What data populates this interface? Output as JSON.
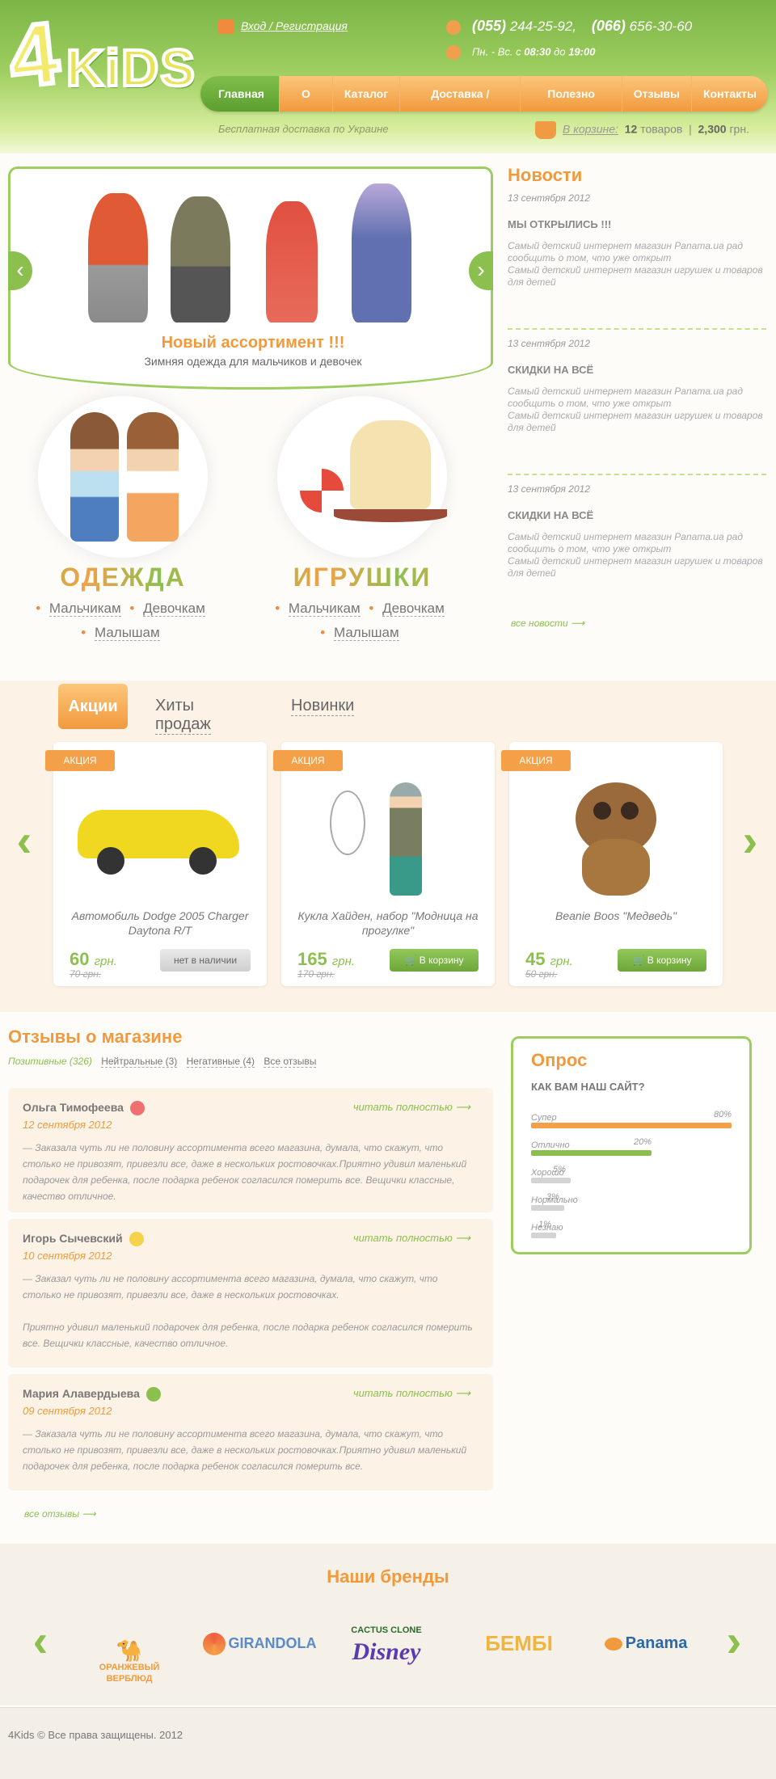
{
  "header": {
    "logo_text": "4KiDS",
    "login": "Вход / Регистрация",
    "phone1_code": "(055)",
    "phone1_num": "244-25-92,",
    "phone2_code": "(066)",
    "phone2_num": "656-30-60",
    "hours_prefix": "Пн. - Вс. с",
    "hours_from": "08:30",
    "hours_mid": "до",
    "hours_to": "19:00",
    "delivery": "Бесплатная доставка по Украине",
    "cart_label": "В корзине:",
    "cart_count": "12",
    "cart_items_word": "товаров",
    "cart_sum": "2,300",
    "cart_currency": "грн."
  },
  "nav": [
    "Главная",
    "О нас",
    "Каталог",
    "Доставка / Оплата",
    "Полезно знать",
    "Отзывы",
    "Контакты"
  ],
  "slider": {
    "title": "Новый ассортимент !!!",
    "subtitle": "Зимняя одежда для мальчиков и девочек"
  },
  "categories": [
    {
      "title": "ОДЕЖДА",
      "links": [
        "Мальчикам",
        "Девочкам",
        "Малышам"
      ]
    },
    {
      "title": "ИГРУШКИ",
      "links": [
        "Мальчикам",
        "Девочкам",
        "Малышам"
      ]
    }
  ],
  "news": {
    "heading": "Новости",
    "items": [
      {
        "date": "13 сентября 2012",
        "title": "МЫ ОТКРЫЛИСЬ !!!",
        "text1": "Самый детский интернет магазин Panama.ua рад сообщить о том, что уже открыт",
        "text2": "Самый детский интернет магазин игрушек и товаров для детей"
      },
      {
        "date": "13 сентября 2012",
        "title": "СКИДКИ НА ВСЁ",
        "text1": "Самый детский интернет магазин Panama.ua рад сообщить о том, что уже открыт",
        "text2": "Самый детский интернет магазин игрушек и товаров для детей"
      },
      {
        "date": "13 сентября 2012",
        "title": "СКИДКИ НА ВСЁ",
        "text1": "Самый детский интернет магазин Panama.ua рад сообщить о том, что уже открыт",
        "text2": "Самый детский интернет магазин игрушек и товаров для детей"
      }
    ],
    "all": "все новости ⟶"
  },
  "product_tabs": [
    "Акции",
    "Хиты продаж",
    "Новинки"
  ],
  "products": [
    {
      "badge": "АКЦИЯ",
      "name": "Автомобиль Dodge 2005 Charger Daytona R/T",
      "price": "60",
      "currency": "грн.",
      "old": "70 грн.",
      "button": "нет в наличии"
    },
    {
      "badge": "АКЦИЯ",
      "name": "Кукла Хайден, набор \"Модница на прогулке\"",
      "price": "165",
      "currency": "грн.",
      "old": "170 грн.",
      "button": "В корзину"
    },
    {
      "badge": "АКЦИЯ",
      "name": "Beanie Boos \"Медведь\"",
      "price": "45",
      "currency": "грн.",
      "old": "50 грн.",
      "button": "В корзину"
    }
  ],
  "reviews": {
    "heading": "Отзывы о магазине",
    "filters": [
      "Позитивные (326)",
      "Нейтральные (3)",
      "Негативные (4)",
      "Все отзывы"
    ],
    "more": "читать полностью ⟶",
    "items": [
      {
        "name": "Ольга Тимофеева",
        "date": "12 сентября 2012",
        "text": "—  Заказала чуть ли не половину ассортимента всего магазина, думала, что скажут, что столько не привозят, привезли все, даже в нескольких ростовочках.Приятно удивил маленький подарочек для ребенка, после подарка ребенок согласился померить все. Вещички классные, качество отличное.",
        "text2": ""
      },
      {
        "name": "Игорь Сычевский",
        "date": "10 сентября 2012",
        "text": "—  Заказал чуть ли не половину ассортимента всего магазина, думала, что скажут, что столько не привозят, привезли все, даже в нескольких ростовочках.",
        "text2": "Приятно удивил маленький подарочек для ребенка, после подарка ребенок согласился померить все. Вещички классные, качество отличное."
      },
      {
        "name": "Мария Алавердыева",
        "date": "09 сентября 2012",
        "text": "—  Заказала чуть ли не половину ассортимента всего магазина, думала, что скажут, что столько не привозят, привезли все, даже в нескольких ростовочках.Приятно удивил маленький подарочек для ребенка, после подарка ребенок согласился померить все.",
        "text2": ""
      }
    ],
    "all": "все отзывы ⟶"
  },
  "poll": {
    "heading": "Опрос",
    "question": "КАК ВАМ НАШ САЙТ?",
    "options": [
      {
        "label": "Супер",
        "percent": "80%",
        "value": 80,
        "color": "#f4a048"
      },
      {
        "label": "Отлично",
        "percent": "20%",
        "value": 20,
        "color": "#8cc04e"
      },
      {
        "label": "Хорошо",
        "percent": "5%",
        "value": 5,
        "color": "#d4d4d4"
      },
      {
        "label": "Нормально",
        "percent": "3%",
        "value": 3,
        "color": "#d4d4d4"
      },
      {
        "label": "Незнаю",
        "percent": "1%",
        "value": 1,
        "color": "#d4d4d4"
      }
    ]
  },
  "brands": {
    "heading": "Наши бренды",
    "items": [
      "ОРАНЖЕВЫЙ ВЕРБЛЮД",
      "GIRANDOLA",
      "CACTUS CLONE",
      "Disney",
      "БЕМБІ",
      "Panama"
    ]
  },
  "footer": "4Kids © Все права защищены. 2012",
  "colors": {
    "accent": "#f19a3d",
    "green": "#8cc04e"
  }
}
